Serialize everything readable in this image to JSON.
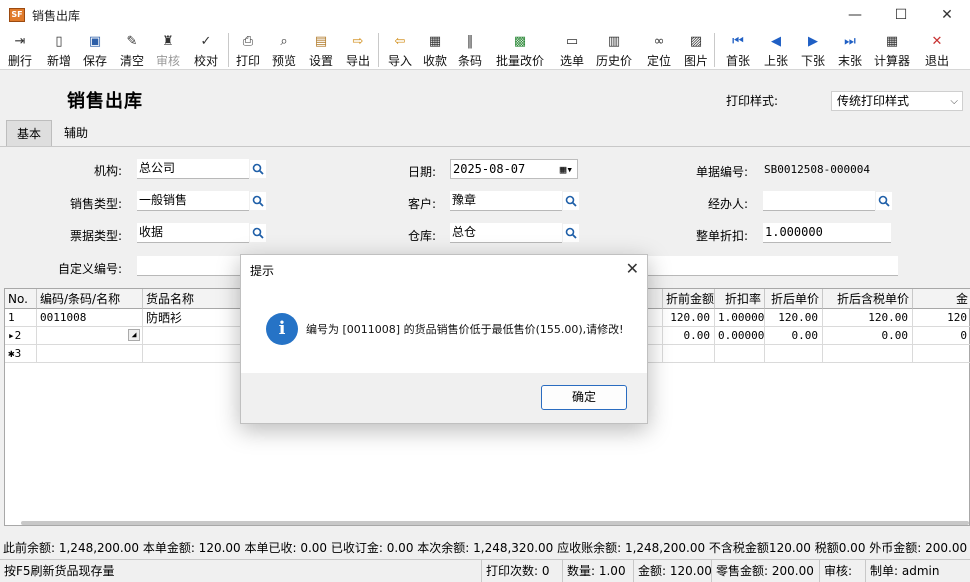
{
  "window": {
    "title": "销售出库",
    "app_icon": "erp-app-icon"
  },
  "toolbar": [
    {
      "label": "删行",
      "icon": "delete-row-icon",
      "glyph": "⇥",
      "enabled": true
    },
    {
      "label": "新增",
      "icon": "new-doc-icon",
      "glyph": "▯",
      "enabled": true
    },
    {
      "label": "保存",
      "icon": "save-disk-icon",
      "glyph": "▣",
      "enabled": true
    },
    {
      "label": "清空",
      "icon": "broom-icon",
      "glyph": "✎",
      "enabled": true
    },
    {
      "label": "审核",
      "icon": "stamp-icon",
      "glyph": "♜",
      "enabled": false
    },
    {
      "label": "校对",
      "icon": "check-icon",
      "glyph": "✓",
      "enabled": true
    },
    {
      "sep": true
    },
    {
      "label": "打印",
      "icon": "printer-icon",
      "glyph": "⎙",
      "enabled": true
    },
    {
      "label": "预览",
      "icon": "preview-icon",
      "glyph": "⌕",
      "enabled": true
    },
    {
      "label": "设置",
      "icon": "settings-box-icon",
      "glyph": "▤",
      "enabled": true
    },
    {
      "label": "导出",
      "icon": "export-icon",
      "glyph": "⇨",
      "enabled": true
    },
    {
      "sep": true
    },
    {
      "label": "导入",
      "icon": "import-icon",
      "glyph": "⇦",
      "enabled": true
    },
    {
      "label": "收款",
      "icon": "receipt-icon",
      "glyph": "▦",
      "enabled": true
    },
    {
      "label": "条码",
      "icon": "barcode-icon",
      "glyph": "‖",
      "enabled": true
    },
    {
      "label": "批量改价",
      "icon": "batch-price-icon",
      "glyph": "▩",
      "enabled": true
    },
    {
      "label": "选单",
      "icon": "select-doc-icon",
      "glyph": "▭",
      "enabled": true
    },
    {
      "label": "历史价",
      "icon": "history-price-icon",
      "glyph": "▥",
      "enabled": true
    },
    {
      "label": "定位",
      "icon": "binoculars-icon",
      "glyph": "∞",
      "enabled": true
    },
    {
      "label": "图片",
      "icon": "picture-icon",
      "glyph": "▨",
      "enabled": true
    },
    {
      "sep": true
    },
    {
      "label": "首张",
      "icon": "first-record-icon",
      "glyph": "⏮",
      "enabled": true
    },
    {
      "label": "上张",
      "icon": "prev-record-icon",
      "glyph": "◀",
      "enabled": true
    },
    {
      "label": "下张",
      "icon": "next-record-icon",
      "glyph": "▶",
      "enabled": true
    },
    {
      "label": "末张",
      "icon": "last-record-icon",
      "glyph": "⏭",
      "enabled": true
    },
    {
      "label": "计算器",
      "icon": "calculator-icon",
      "glyph": "▦",
      "enabled": true
    },
    {
      "label": "退出",
      "icon": "exit-icon",
      "glyph": "✕",
      "enabled": true
    }
  ],
  "header": {
    "title": "销售出库",
    "print_style_label": "打印样式:",
    "print_style_value": "传统打印样式"
  },
  "tabs": [
    {
      "label": "基本",
      "active": true
    },
    {
      "label": "辅助",
      "active": false
    }
  ],
  "form": {
    "org_label": "机构:",
    "org_value": "总公司",
    "sales_type_label": "销售类型:",
    "sales_type_value": "一般销售",
    "ticket_type_label": "票据类型:",
    "ticket_type_value": "收据",
    "custom_no_label": "自定义编号:",
    "custom_no_value": "",
    "date_label": "日期:",
    "date_value": "2025-08-07",
    "customer_label": "客户:",
    "customer_value": "豫章",
    "warehouse_label": "仓库:",
    "warehouse_value": "总仓",
    "doc_no_label": "单据编号:",
    "doc_no_value": "SB0012508-000004",
    "handler_label": "经办人:",
    "handler_value": "",
    "discount_label": "整单折扣:",
    "discount_value": "1.000000"
  },
  "grid": {
    "columns": [
      "No.",
      "编码/条码/名称",
      "货品名称",
      "折前金额",
      "折扣率",
      "折后单价",
      "折后含税单价",
      "金"
    ],
    "rows": [
      {
        "no": "1",
        "code": "0011008",
        "name": "防晒衫",
        "pre_amount": "120.00",
        "rate": "1.00000",
        "unit_price": "120.00",
        "tax_price": "120.00",
        "amount": "120"
      },
      {
        "no": "▸2",
        "code": "",
        "name": "",
        "pre_amount": "0.00",
        "rate": "0.00000",
        "unit_price": "0.00",
        "tax_price": "0.00",
        "amount": "0"
      },
      {
        "no": "✱3",
        "code": "",
        "name": "",
        "pre_amount": "",
        "rate": "",
        "unit_price": "",
        "tax_price": "",
        "amount": ""
      }
    ]
  },
  "summary": "此前余额: 1,248,200.00 本单金额: 120.00 本单已收: 0.00 已收订金: 0.00 本次余额: 1,248,320.00 应收账余额: 1,248,200.00 不含税金额120.00 税额0.00 外币金额: 200.00",
  "statusbar": {
    "hint": "按F5刷新货品现存量",
    "print_count": "打印次数: 0",
    "quantity": "数量: 1.00",
    "amount": "金额: 120.00",
    "retail_amount": "零售金额: 200.00",
    "auditor": "审核:",
    "creator": "制单: admin"
  },
  "dialog": {
    "title": "提示",
    "message": "编号为 [0011008] 的货品销售价低于最低售价(155.00),请修改!",
    "ok_label": "确定",
    "info_glyph": "i"
  },
  "colors": {
    "accent": "#2673c6",
    "ok_border": "#2a6cc0"
  }
}
